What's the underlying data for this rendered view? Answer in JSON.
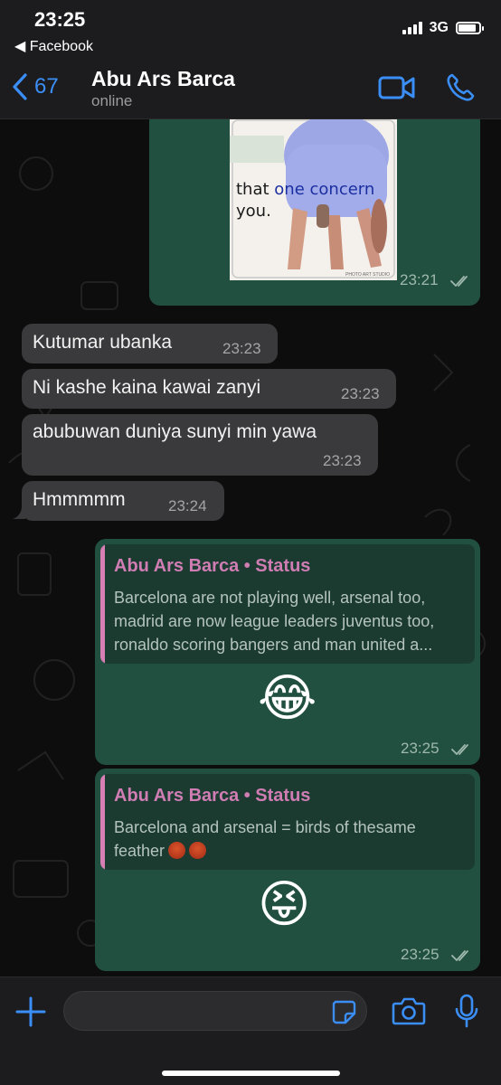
{
  "status_bar": {
    "time": "23:25",
    "back_app": "◀ Facebook",
    "network": "3G",
    "battery_level": 0.85
  },
  "header": {
    "back_count": "67",
    "contact_name": "Abu Ars Barca",
    "contact_status": "online"
  },
  "messages": [
    {
      "type": "image",
      "direction": "outgoing",
      "image_text_1": "that",
      "image_text_2": "one concern",
      "image_text_3": "you.",
      "image_credit": "PHOTO ART STUDIO",
      "time": "23:21"
    },
    {
      "type": "text",
      "direction": "incoming",
      "text": "Kutumar ubanka",
      "time": "23:23"
    },
    {
      "type": "text",
      "direction": "incoming",
      "text": "Ni kashe kaina kawai zanyi",
      "time": "23:23"
    },
    {
      "type": "text",
      "direction": "incoming",
      "text": "abubuwan duniya sunyi min yawa",
      "time": "23:23"
    },
    {
      "type": "text",
      "direction": "incoming",
      "text": "Hmmmmm",
      "time": "23:24"
    },
    {
      "type": "status_reply",
      "direction": "outgoing",
      "quote_title": "Abu Ars Barca • Status",
      "quote_line_1": "Barcelona are not playing well, arsenal too,",
      "quote_line_2": "madrid are now league leaders juventus too,",
      "quote_line_3": "ronaldo scoring bangers and man united a...",
      "emoji": "😂",
      "time": "23:25"
    },
    {
      "type": "status_reply",
      "direction": "outgoing",
      "quote_title": "Abu Ars Barca • Status",
      "quote_line_1": "Barcelona and arsenal = birds of thesame",
      "quote_line_2": "feather",
      "emoji": "😝",
      "time": "23:25"
    }
  ],
  "input": {
    "placeholder": ""
  },
  "icons": {
    "back": "chevron-left-icon",
    "video": "video-camera-icon",
    "call": "phone-icon",
    "plus": "plus-icon",
    "sticker": "sticker-icon",
    "camera": "camera-icon",
    "mic": "microphone-icon"
  },
  "colors": {
    "accent": "#3a8ef6",
    "outgoing_bubble": "#215040",
    "incoming_bubble": "#3a3a3c",
    "quote_name": "#cf7db3"
  }
}
